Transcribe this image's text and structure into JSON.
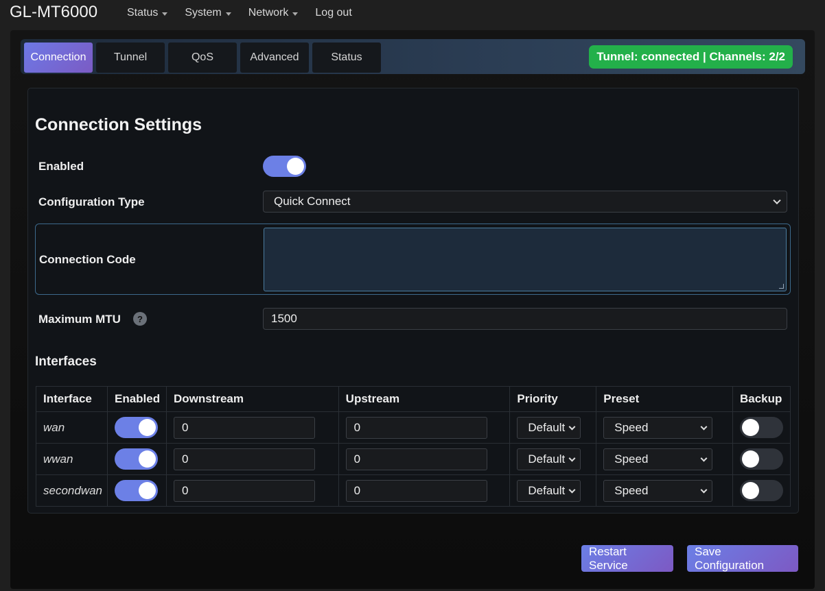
{
  "app": {
    "title": "GL-MT6000"
  },
  "nav": [
    {
      "label": "Status"
    },
    {
      "label": "System"
    },
    {
      "label": "Network"
    },
    {
      "label": "Log out"
    }
  ],
  "tabs": [
    {
      "label": "Connection",
      "active": true
    },
    {
      "label": "Tunnel"
    },
    {
      "label": "QoS"
    },
    {
      "label": "Advanced"
    },
    {
      "label": "Status"
    }
  ],
  "status_badge": "Tunnel: connected | Channels: 2/2",
  "settings": {
    "title": "Connection Settings",
    "enabled_label": "Enabled",
    "enabled": true,
    "config_type_label": "Configuration Type",
    "config_type_value": "Quick Connect",
    "connection_code_label": "Connection Code",
    "connection_code_value": "",
    "mtu_label": "Maximum MTU",
    "mtu_value": "1500",
    "help_glyph": "?"
  },
  "interfaces": {
    "title": "Interfaces",
    "columns": [
      "Interface",
      "Enabled",
      "Downstream",
      "Upstream",
      "Priority",
      "Preset",
      "Backup"
    ],
    "rows": [
      {
        "name": "wan",
        "enabled": true,
        "downstream": "0",
        "upstream": "0",
        "priority": "Default",
        "preset": "Speed",
        "backup": false
      },
      {
        "name": "wwan",
        "enabled": true,
        "downstream": "0",
        "upstream": "0",
        "priority": "Default",
        "preset": "Speed",
        "backup": false
      },
      {
        "name": "secondwan",
        "enabled": true,
        "downstream": "0",
        "upstream": "0",
        "priority": "Default",
        "preset": "Speed",
        "backup": false
      }
    ]
  },
  "buttons": {
    "restart": "Restart Service",
    "save": "Save Configuration"
  },
  "colors": {
    "accent": "#6c80e6",
    "status_green": "#23b04a",
    "background": "#1f1f1f"
  }
}
